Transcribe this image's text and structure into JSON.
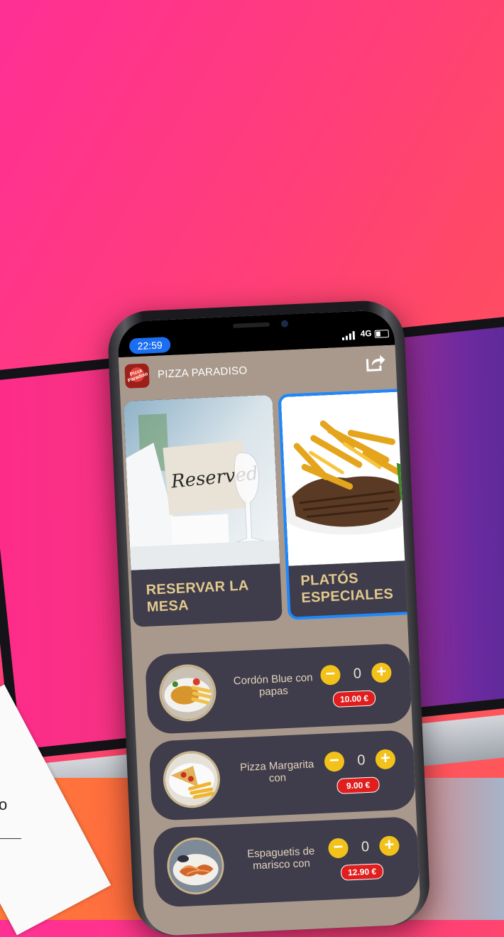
{
  "status": {
    "time": "22:59",
    "network": "4G"
  },
  "app": {
    "title": "PIZZA PARADISO",
    "logo_text": "Pizza Paradiso"
  },
  "cards": [
    {
      "label": "RESERVAR LA MESA",
      "photo_text": "Reserved"
    },
    {
      "label": "PLATÓS ESPECIALES"
    }
  ],
  "menu": [
    {
      "name": "Cordón Blue con papas",
      "qty": "0",
      "price": "10.00 €"
    },
    {
      "name": "Pizza Margarita con",
      "qty": "0",
      "price": "9.00 €"
    },
    {
      "name": "Espaguetis de marisco con",
      "qty": "0",
      "price": "12.90 €"
    }
  ],
  "controls": {
    "minus": "−",
    "plus": "+"
  },
  "colors": {
    "accent_gold": "#f2c21a",
    "price_red": "#e11e1e",
    "card_dark": "#3f3d4b",
    "label_gold": "#e2c98e",
    "selected_border": "#1e88ff"
  },
  "icons": [
    "share-icon",
    "app-logo"
  ]
}
